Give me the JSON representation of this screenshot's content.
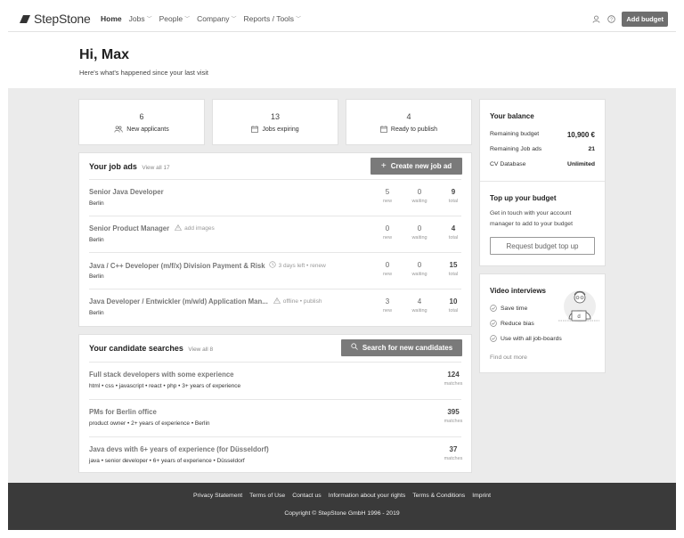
{
  "brand": {
    "logo_text": "StepStone"
  },
  "nav": {
    "items": [
      {
        "label": "Home"
      },
      {
        "label": "Jobs"
      },
      {
        "label": "People"
      },
      {
        "label": "Company"
      },
      {
        "label": "Reports / Tools"
      }
    ],
    "add_budget": "Add budget"
  },
  "hero": {
    "greeting": "Hi, Max",
    "subtitle": "Here's what's happened since your last visit"
  },
  "stats": [
    {
      "value": "6",
      "label": "New applicants",
      "icon": "people-icon"
    },
    {
      "value": "13",
      "label": "Jobs expiring",
      "icon": "calendar-icon"
    },
    {
      "value": "4",
      "label": "Ready to publish",
      "icon": "calendar-icon"
    }
  ],
  "job_ads": {
    "title": "Your job ads",
    "view_all": "View all 17",
    "create_button": "Create new job ad",
    "rows": [
      {
        "title": "Senior Java Developer",
        "note": "",
        "location": "Berlin",
        "new": "5",
        "waiting": "0",
        "total": "9"
      },
      {
        "title": "Senior Product Manager",
        "note": "add images",
        "location": "Berlin",
        "new": "0",
        "waiting": "0",
        "total": "4"
      },
      {
        "title": "Java / C++ Developer (m/f/x) Division Payment & Risk",
        "note": "3 days left • renew",
        "location": "Berlin",
        "new": "0",
        "waiting": "0",
        "total": "15"
      },
      {
        "title": "Java Developer / Entwickler (m/w/d) Application Man...",
        "note": "offline • publish",
        "location": "Berlin",
        "new": "3",
        "waiting": "4",
        "total": "10"
      }
    ],
    "metric_labels": {
      "new": "new",
      "waiting": "waiting",
      "total": "total"
    }
  },
  "searches": {
    "title": "Your candidate searches",
    "view_all": "View all 8",
    "search_button": "Search for new candidates",
    "rows": [
      {
        "title": "Full stack developers with some experience",
        "tags": "html  •  css  •  javascript  •  react  •  php  •  3+ years of experience",
        "matches": "124"
      },
      {
        "title": "PMs for Berlin office",
        "tags": "product owner  •  2+ years of experience  •  Berlin",
        "matches": "395"
      },
      {
        "title": "Java devs with 6+ years of experience (for Düsseldorf)",
        "tags": "java  •  senior developer  •  6+ years of experience  •  Düsseldorf",
        "matches": "37"
      }
    ],
    "matches_label": "matches"
  },
  "balance": {
    "title": "Your balance",
    "rows": [
      {
        "label": "Remaining budget",
        "value": "10,900 €"
      },
      {
        "label": "Remaining Job ads",
        "value": "21"
      },
      {
        "label": "CV Database",
        "value": "Unlimited"
      }
    ],
    "topup_title": "Top up your budget",
    "topup_text": "Get in touch with your account manager to add to your budget",
    "topup_button": "Request budget top up"
  },
  "video": {
    "title": "Video interviews",
    "items": [
      "Save time",
      "Reduce bias",
      "Use with all job-boards"
    ],
    "find_more": "Find out more"
  },
  "footer": {
    "links": [
      "Privacy Statement",
      "Terms of Use",
      "Contact us",
      "Information about your rights",
      "Terms & Conditions",
      "Imprint"
    ],
    "copyright": "Copyright © StepStone GmbH 1996 - 2019"
  }
}
